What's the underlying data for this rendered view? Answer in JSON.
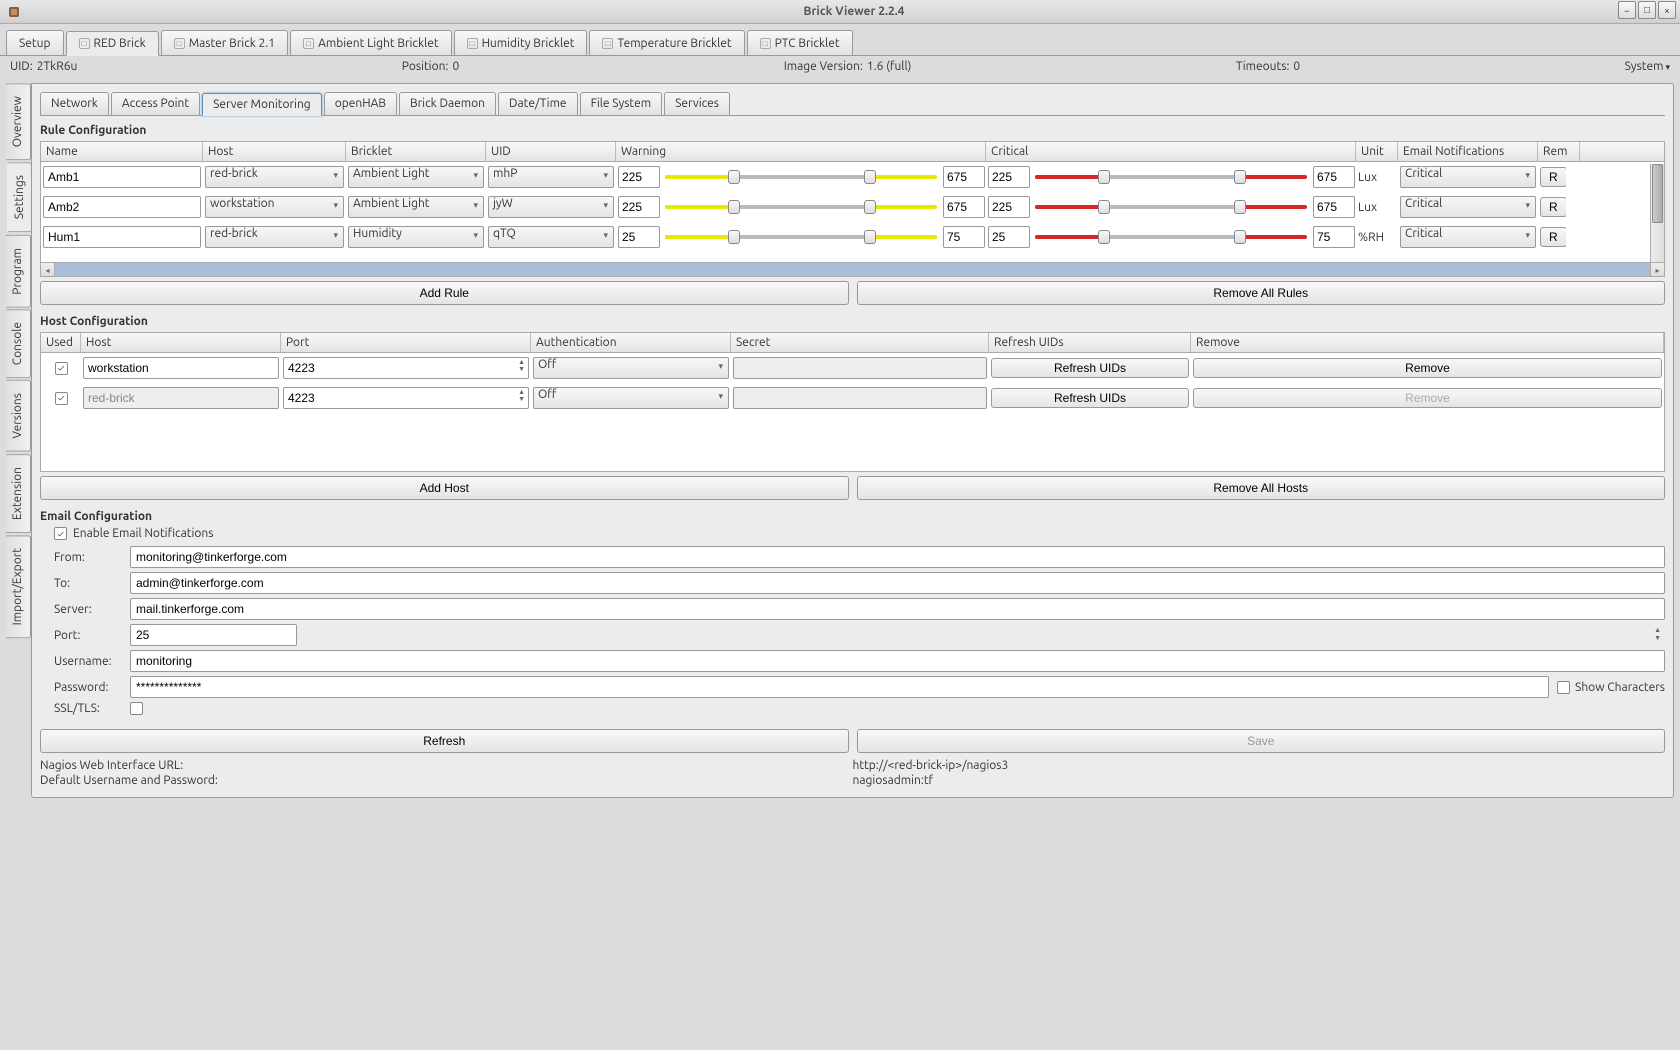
{
  "window": {
    "title": "Brick Viewer 2.2.4"
  },
  "mainTabs": [
    "Setup",
    "RED Brick",
    "Master Brick 2.1",
    "Ambient Light Bricklet",
    "Humidity Bricklet",
    "Temperature Bricklet",
    "PTC Bricklet"
  ],
  "infoBar": {
    "uidLabel": "UID:",
    "uidValue": "2TkR6u",
    "posLabel": "Position:",
    "posValue": "0",
    "verLabel": "Image Version:",
    "verValue": "1.6 (full)",
    "timeoutLabel": "Timeouts:",
    "timeoutValue": "0",
    "system": "System"
  },
  "sideTabs": [
    "Overview",
    "Settings",
    "Program",
    "Console",
    "Versions",
    "Extension",
    "Import/Export"
  ],
  "subTabs": [
    "Network",
    "Access Point",
    "Server Monitoring",
    "openHAB",
    "Brick Daemon",
    "Date/Time",
    "File System",
    "Services"
  ],
  "ruleConfig": {
    "title": "Rule Configuration",
    "headers": [
      "Name",
      "Host",
      "Bricklet",
      "UID",
      "Warning",
      "Critical",
      "Unit",
      "Email Notifications",
      "Rem"
    ],
    "rows": [
      {
        "name": "Amb1",
        "host": "red-brick",
        "bricklet": "Ambient Light",
        "uid": "mhP",
        "wlo": "225",
        "whi": "675",
        "clo": "225",
        "chi": "675",
        "unit": "Lux",
        "email": "Critical",
        "rem": "R"
      },
      {
        "name": "Amb2",
        "host": "workstation",
        "bricklet": "Ambient Light",
        "uid": "jyW",
        "wlo": "225",
        "whi": "675",
        "clo": "225",
        "chi": "675",
        "unit": "Lux",
        "email": "Critical",
        "rem": "R"
      },
      {
        "name": "Hum1",
        "host": "red-brick",
        "bricklet": "Humidity",
        "uid": "qTQ",
        "wlo": "25",
        "whi": "75",
        "clo": "25",
        "chi": "75",
        "unit": "%RH",
        "email": "Critical",
        "rem": "R"
      }
    ],
    "addBtn": "Add Rule",
    "removeAllBtn": "Remove All Rules"
  },
  "hostConfig": {
    "title": "Host Configuration",
    "headers": [
      "Used",
      "Host",
      "Port",
      "Authentication",
      "Secret",
      "Refresh UIDs",
      "Remove"
    ],
    "rows": [
      {
        "used": true,
        "host": "workstation",
        "port": "4223",
        "auth": "Off",
        "secret": "",
        "refresh": "Refresh UIDs",
        "remove": "Remove",
        "removeDisabled": false
      },
      {
        "used": true,
        "host": "red-brick",
        "port": "4223",
        "auth": "Off",
        "secret": "",
        "refresh": "Refresh UIDs",
        "remove": "Remove",
        "removeDisabled": true
      }
    ],
    "addBtn": "Add Host",
    "removeAllBtn": "Remove All Hosts"
  },
  "emailConfig": {
    "title": "Email Configuration",
    "enableLabel": "Enable Email Notifications",
    "enableChecked": true,
    "fromLabel": "From:",
    "fromValue": "monitoring@tinkerforge.com",
    "toLabel": "To:",
    "toValue": "admin@tinkerforge.com",
    "serverLabel": "Server:",
    "serverValue": "mail.tinkerforge.com",
    "portLabel": "Port:",
    "portValue": "25",
    "userLabel": "Username:",
    "userValue": "monitoring",
    "passLabel": "Password:",
    "passValue": "**************",
    "showCharsLabel": "Show Characters",
    "sslLabel": "SSL/TLS:"
  },
  "bottom": {
    "refreshBtn": "Refresh",
    "saveBtn": "Save",
    "nagiosUrlLabel": "Nagios Web Interface URL:",
    "nagiosUrlValue": "http://<red-brick-ip>/nagios3",
    "credLabel": "Default Username and Password:",
    "credValue": "nagiosadmin:tf"
  }
}
